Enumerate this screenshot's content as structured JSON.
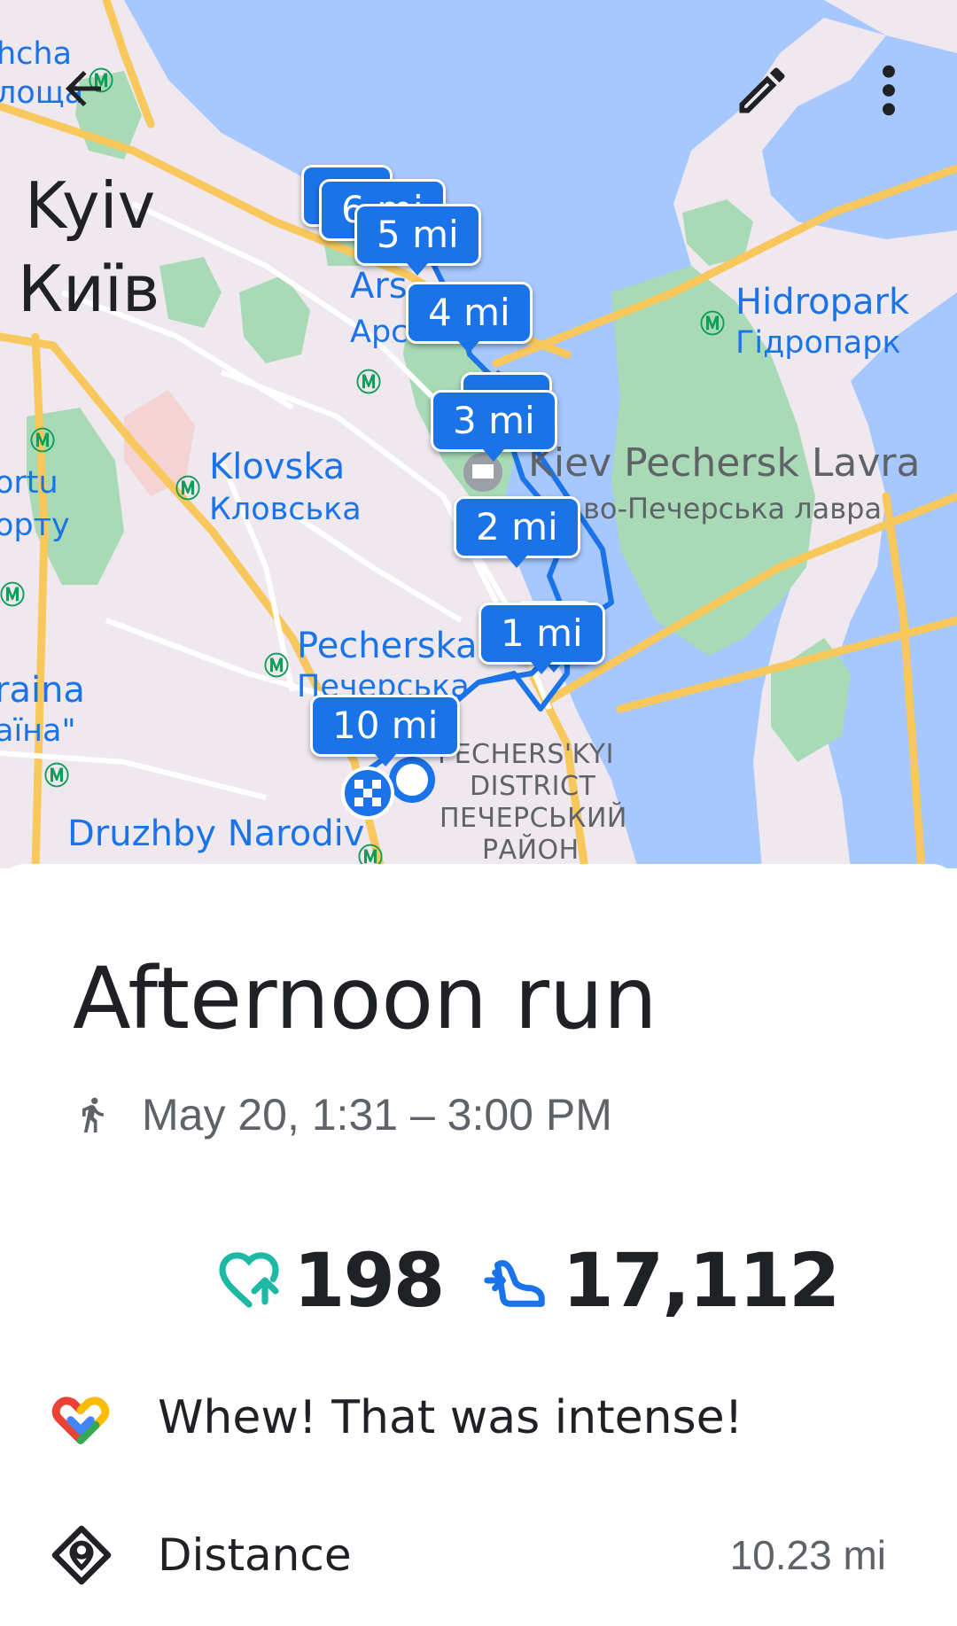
{
  "map": {
    "city_en": "Kyiv",
    "city_uk": "Київ",
    "places": {
      "top_left_a": "hcha",
      "top_left_b": "лоща",
      "arsenalna_a": "Ars",
      "arsenalna_b": "Арс",
      "hidropark_en": "Hidropark",
      "hidropark_uk": "Гідропарк",
      "klovska_en": "Klovska",
      "klovska_uk": "Кловська",
      "lavra_en": "Kiev Pechersk Lavra",
      "lavra_uk": "во-Печерська лавра",
      "left_a": "ortu",
      "left_b": "орту",
      "pecherska_en": "Pecherska",
      "pecherska_uk": "Печерська",
      "left_c": "raina",
      "left_d": "аїна\"",
      "district_1": "PECHERS'KYI",
      "district_2": "DISTRICT",
      "district_3": "ПЕЧЕРСЬКИЙ",
      "district_4": "РАЙОН",
      "druzhby": "Druzhby Narodiv"
    },
    "metro_symbol": "Ⓜ",
    "mile_markers": [
      "1 mi",
      "2 mi",
      "3 mi",
      "4 mi",
      "5 mi",
      "6 mi",
      "10 mi"
    ],
    "colors": {
      "water": "#a6c8ff",
      "land": "#efe9ef",
      "park": "#a8dab5",
      "highway": "#f8c85c",
      "route": "#1a73e8"
    }
  },
  "toolbar": {
    "back_icon": "arrow-back-icon",
    "edit_icon": "pencil-icon",
    "menu_icon": "more-vert-icon"
  },
  "activity": {
    "title": "Afternoon run",
    "type_icon": "running-icon",
    "datetime": "May 20, 1:31 – 3:00 PM",
    "heart_points": "198",
    "steps": "17,112",
    "note": "Whew! That was intense!",
    "distance_label": "Distance",
    "distance_value": "10.23 mi"
  },
  "colors": {
    "heart_points": "#1db9a4",
    "steps": "#1a73e8",
    "text_primary": "#202124",
    "text_secondary": "#5f6368"
  }
}
